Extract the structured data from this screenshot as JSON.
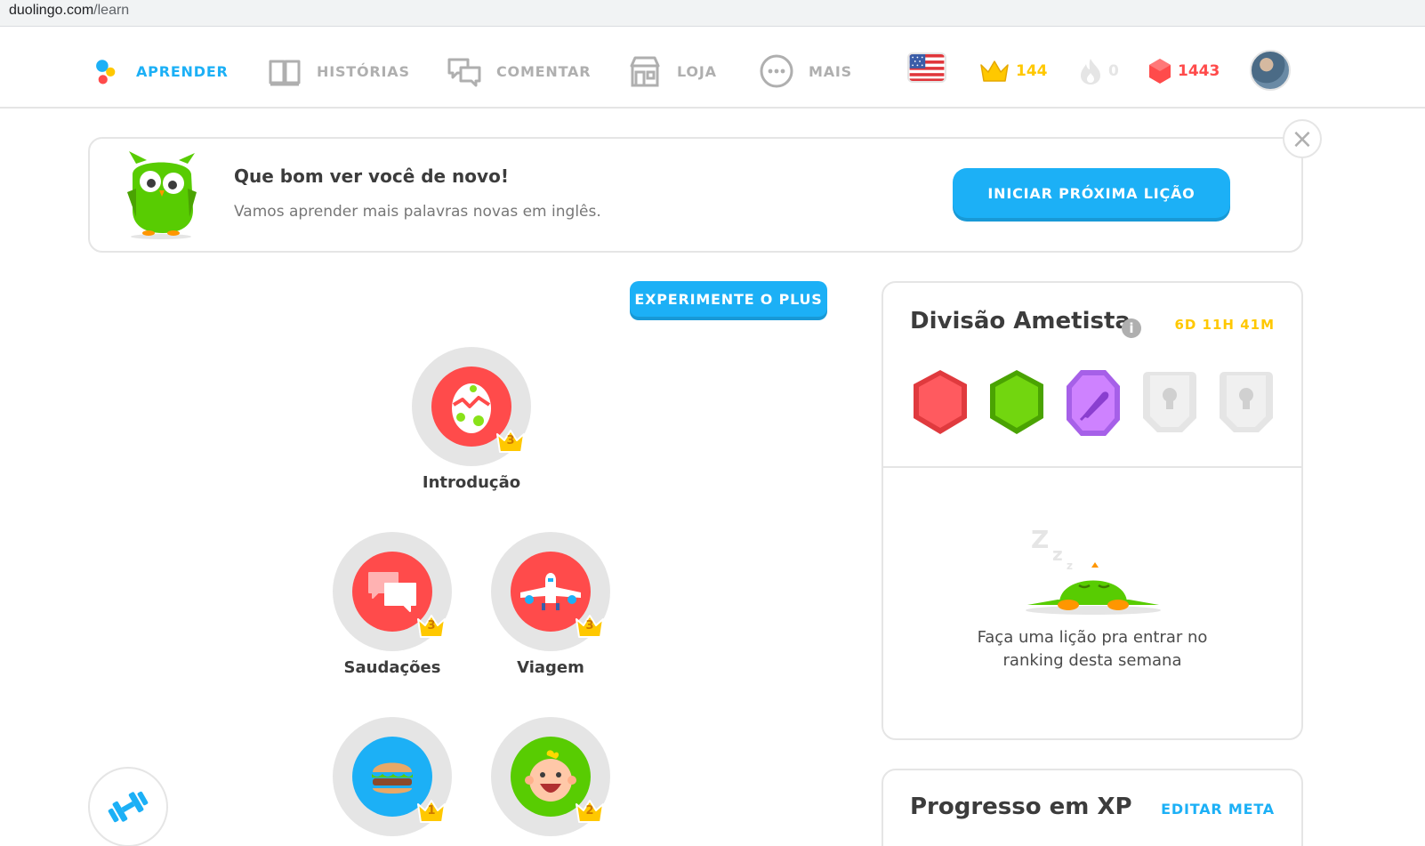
{
  "browser": {
    "url_host": "duolingo.com",
    "url_path": "/learn"
  },
  "nav": {
    "items": [
      {
        "label": "APRENDER",
        "icon": "learn-dots-icon",
        "active": true
      },
      {
        "label": "HISTÓRIAS",
        "icon": "book-icon",
        "active": false
      },
      {
        "label": "COMENTAR",
        "icon": "chat-bubbles-icon",
        "active": false
      },
      {
        "label": "LOJA",
        "icon": "shop-icon",
        "active": false
      },
      {
        "label": "MAIS",
        "icon": "more-dots-icon",
        "active": false
      }
    ],
    "crowns": "144",
    "streak": "0",
    "gems": "1443"
  },
  "welcome": {
    "title": "Que bom ver você de novo!",
    "subtitle": "Vamos aprender mais palavras novas em inglês.",
    "button": "INICIAR PRÓXIMA LIÇÃO"
  },
  "plus_button": "EXPERIMENTE O PLUS",
  "skills": [
    {
      "name": "Introdução",
      "crown_level": "3",
      "color": "#ff4b4b",
      "icon": "egg-icon"
    },
    {
      "name": "Saudações",
      "crown_level": "3",
      "color": "#ff4b4b",
      "icon": "speech-bubbles-icon"
    },
    {
      "name": "Viagem",
      "crown_level": "3",
      "color": "#ff4b4b",
      "icon": "airplane-icon"
    },
    {
      "name": "",
      "crown_level": "1",
      "color": "#1cb0f6",
      "icon": "burger-icon"
    },
    {
      "name": "",
      "crown_level": "2",
      "color": "#58cc02",
      "icon": "baby-face-icon"
    }
  ],
  "league": {
    "title": "Divisão Ametista",
    "timer": "6D 11H 41M",
    "badges": [
      "ruby-badge",
      "emerald-badge",
      "amethyst-badge",
      "locked-badge",
      "locked-badge"
    ],
    "message_line1": "Faça uma lição pra entrar no",
    "message_line2": "ranking desta semana"
  },
  "xp": {
    "title": "Progresso em XP",
    "edit": "EDITAR META"
  },
  "colors": {
    "blue": "#1cb0f6",
    "gold": "#ffc800",
    "red": "#ff4b4b",
    "green": "#58cc02",
    "purple": "#ce82ff",
    "gray": "#afafaf"
  }
}
